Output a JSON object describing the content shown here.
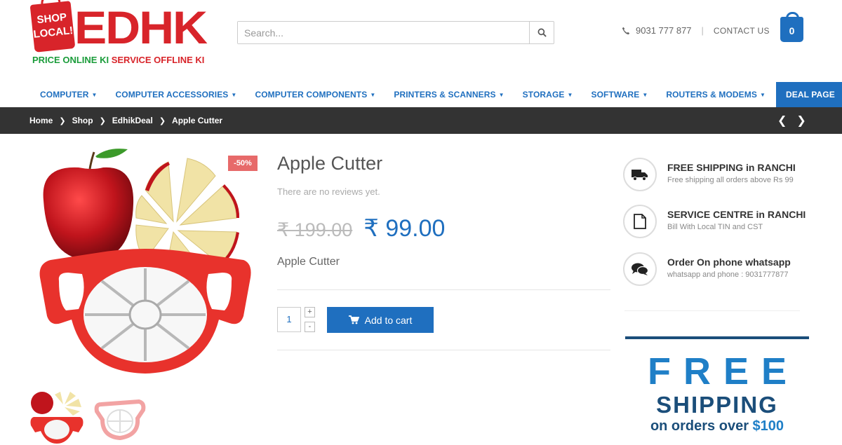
{
  "header": {
    "logo": {
      "bag_text_1": "SHOP",
      "bag_text_2": "LOCAL!",
      "wordmark": "EDHK",
      "tagline_part1": "PRICE ONLINE KI",
      "tagline_part2": "SERVICE OFFLINE KI"
    },
    "search": {
      "placeholder": "Search..."
    },
    "phone": "9031 777 877",
    "contact_label": "CONTACT US",
    "cart_count": "0"
  },
  "nav": {
    "items": [
      {
        "label": "COMPUTER"
      },
      {
        "label": "COMPUTER ACCESSORIES"
      },
      {
        "label": "COMPUTER COMPONENTS"
      },
      {
        "label": "PRINTERS & SCANNERS"
      },
      {
        "label": "STORAGE"
      },
      {
        "label": "SOFTWARE"
      },
      {
        "label": "ROUTERS & MODEMS"
      }
    ],
    "deal_label": "DEAL PAGE"
  },
  "breadcrumb": [
    "Home",
    "Shop",
    "EdhikDeal",
    "Apple Cutter"
  ],
  "product": {
    "badge": "-50%",
    "title": "Apple Cutter",
    "reviews_text": "There are no reviews yet.",
    "old_price": "₹ 199.00",
    "new_price": "₹ 99.00",
    "short_description": "Apple Cutter",
    "quantity": "1",
    "qty_plus": "+",
    "qty_minus": "-",
    "add_to_cart_label": "Add to cart"
  },
  "features": [
    {
      "icon": "truck-icon",
      "title": "FREE SHIPPING in RANCHI",
      "subtitle": "Free shipping all orders above  Rs 99"
    },
    {
      "icon": "document-icon",
      "title": "SERVICE CENTRE in RANCHI",
      "subtitle": "Bill With Local TIN and CST"
    },
    {
      "icon": "chat-icon",
      "title": "Order On phone whatsapp",
      "subtitle": "whatsapp and phone : 9031777877"
    }
  ],
  "banner": {
    "line1": "FREE",
    "line2": "SHIPPING",
    "line3_prefix": "on orders over",
    "line3_amount": "$100"
  },
  "colors": {
    "brand_blue": "#1f6fbf",
    "brand_red": "#d8242a",
    "brand_green": "#1a9c3a",
    "breadcrumb_bg": "#333333",
    "sale_badge": "#e76a6a"
  }
}
